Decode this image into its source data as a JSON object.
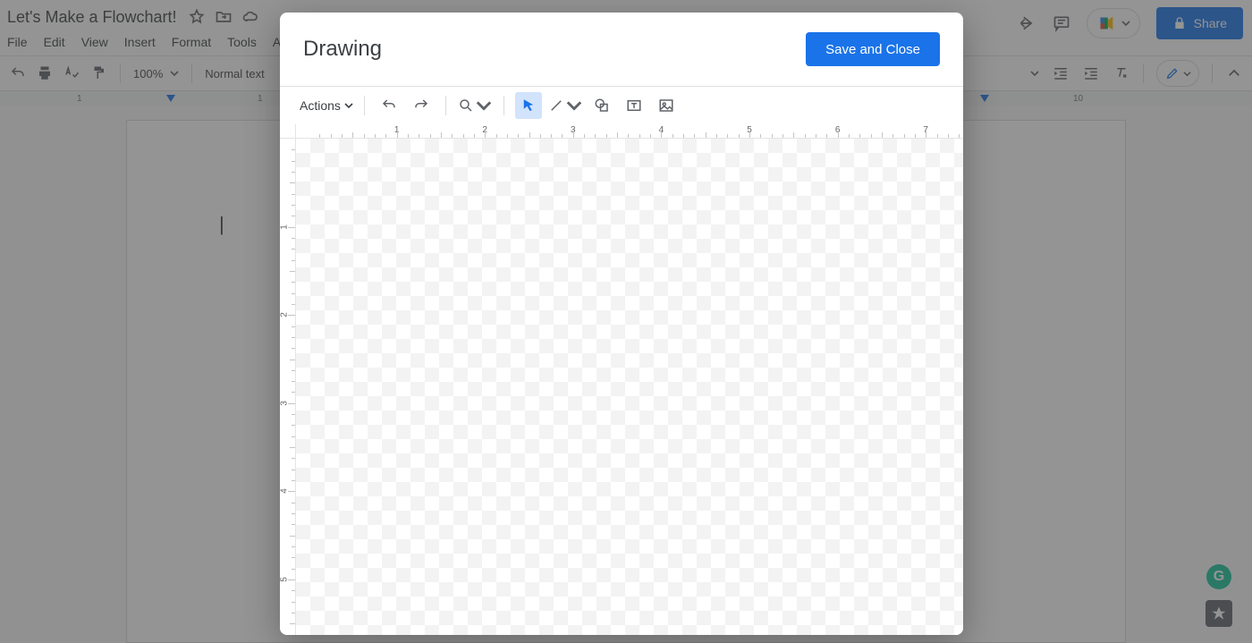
{
  "doc": {
    "title": "Let's Make a Flowchart!",
    "menus": [
      "File",
      "Edit",
      "View",
      "Insert",
      "Format",
      "Tools",
      "A"
    ],
    "zoom": "100%",
    "style": "Normal text",
    "bg_ruler": {
      "left_mark": "1",
      "one": "1",
      "ten": "10"
    },
    "share_label": "Share"
  },
  "drawing": {
    "title": "Drawing",
    "save_label": "Save and Close",
    "actions_label": "Actions",
    "hruler": [
      "1",
      "2",
      "3",
      "4",
      "5",
      "6",
      "7"
    ],
    "vruler": [
      "1",
      "2",
      "3",
      "4",
      "5"
    ]
  }
}
